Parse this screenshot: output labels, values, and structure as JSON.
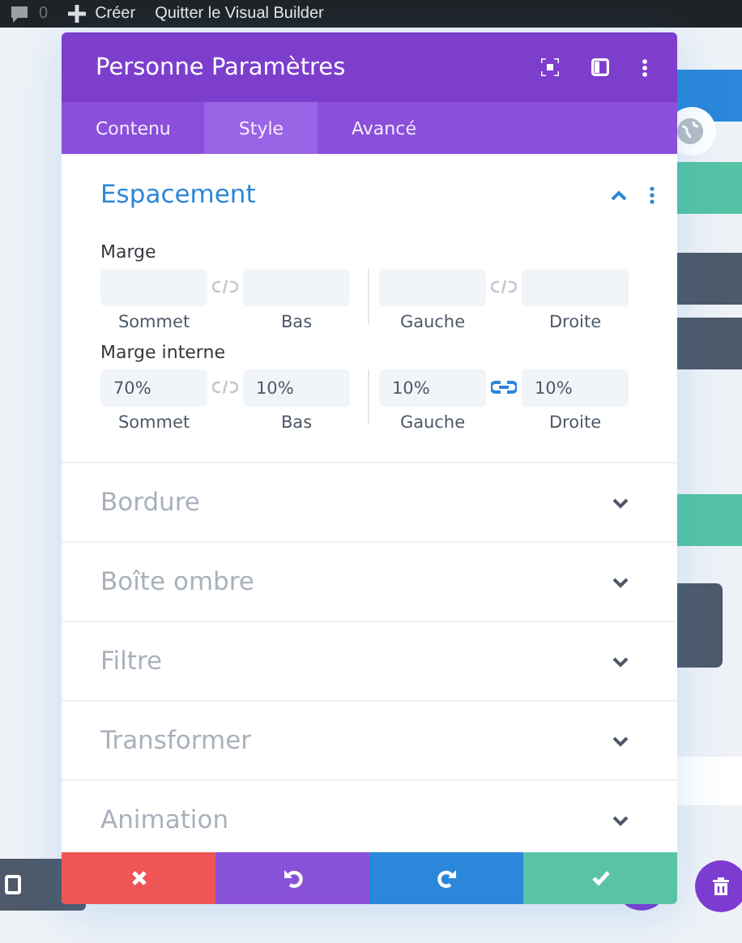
{
  "admin_bar": {
    "comments_count": "0",
    "create": "Créer",
    "exit": "Quitter le Visual Builder"
  },
  "modal": {
    "title": "Personne Paramètres",
    "tabs": [
      {
        "label": "Contenu",
        "selected": false
      },
      {
        "label": "Style",
        "selected": true
      },
      {
        "label": "Avancé",
        "selected": false
      }
    ],
    "sections": [
      {
        "title": "Espacement",
        "expanded": true,
        "groups": [
          {
            "label": "Marge",
            "pairs": [
              {
                "linked": false,
                "fields": [
                  {
                    "label": "Sommet"
                  },
                  {
                    "label": "Bas"
                  }
                ]
              },
              {
                "linked": false,
                "fields": [
                  {
                    "label": "Gauche"
                  },
                  {
                    "label": "Droite"
                  }
                ]
              }
            ]
          },
          {
            "label": "Marge interne",
            "pairs": [
              {
                "linked": false,
                "fields": [
                  {
                    "label": "Sommet",
                    "value": "70%"
                  },
                  {
                    "label": "Bas",
                    "value": "10%"
                  }
                ]
              },
              {
                "linked": true,
                "fields": [
                  {
                    "label": "Gauche",
                    "value": "10%"
                  },
                  {
                    "label": "Droite",
                    "value": "10%"
                  }
                ]
              }
            ]
          }
        ]
      },
      {
        "title": "Bordure",
        "expanded": false
      },
      {
        "title": "Boîte ombre",
        "expanded": false
      },
      {
        "title": "Filtre",
        "expanded": false
      },
      {
        "title": "Transformer",
        "expanded": false
      },
      {
        "title": "Animation",
        "expanded": false
      }
    ],
    "footer_buttons": [
      {
        "kind": "cancel"
      },
      {
        "kind": "undo"
      },
      {
        "kind": "redo"
      },
      {
        "kind": "save"
      }
    ]
  }
}
